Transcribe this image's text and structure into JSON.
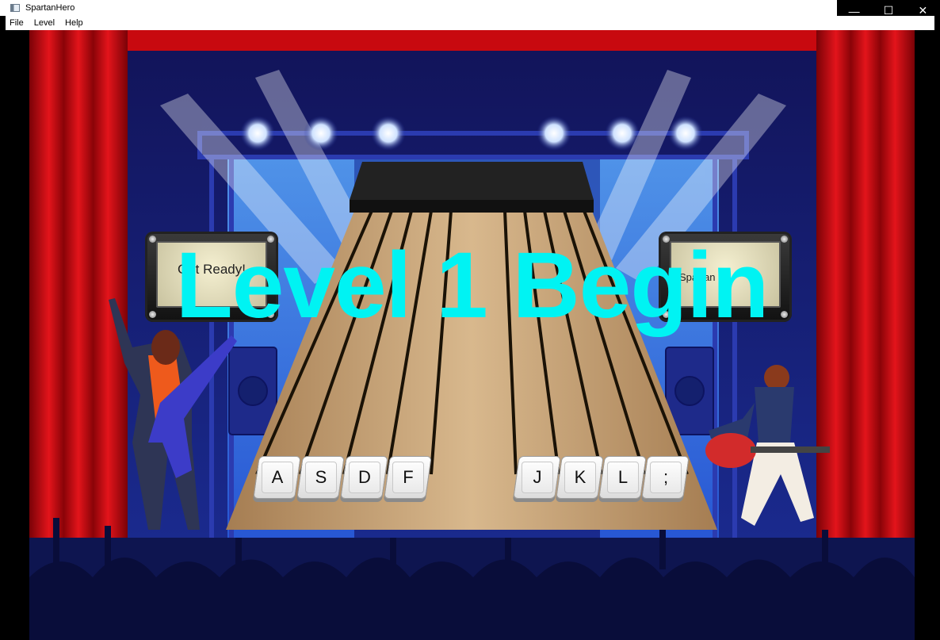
{
  "window": {
    "title": "SpartanHero",
    "controls": {
      "minimize": "—",
      "maximize": "☐",
      "close": "✕"
    }
  },
  "menu": [
    "File",
    "Level",
    "Help"
  ],
  "game": {
    "banner": "Level 1 Begin",
    "meters": {
      "left_text": "Get Ready!",
      "right_text": "Spartan"
    },
    "keys_left": [
      "A",
      "S",
      "D",
      "F"
    ],
    "keys_right": [
      "J",
      "K",
      "L",
      ";"
    ],
    "colors": {
      "banner": "#00f3f3",
      "curtain": "#c8090f",
      "stage_bg": "#0b0d3b",
      "highway_wood": "#c9a57a"
    },
    "icons": [
      "app-icon",
      "stage-light-icon",
      "guitarist-left",
      "guitarist-right",
      "crowd-silhouette",
      "speaker-icon"
    ]
  }
}
